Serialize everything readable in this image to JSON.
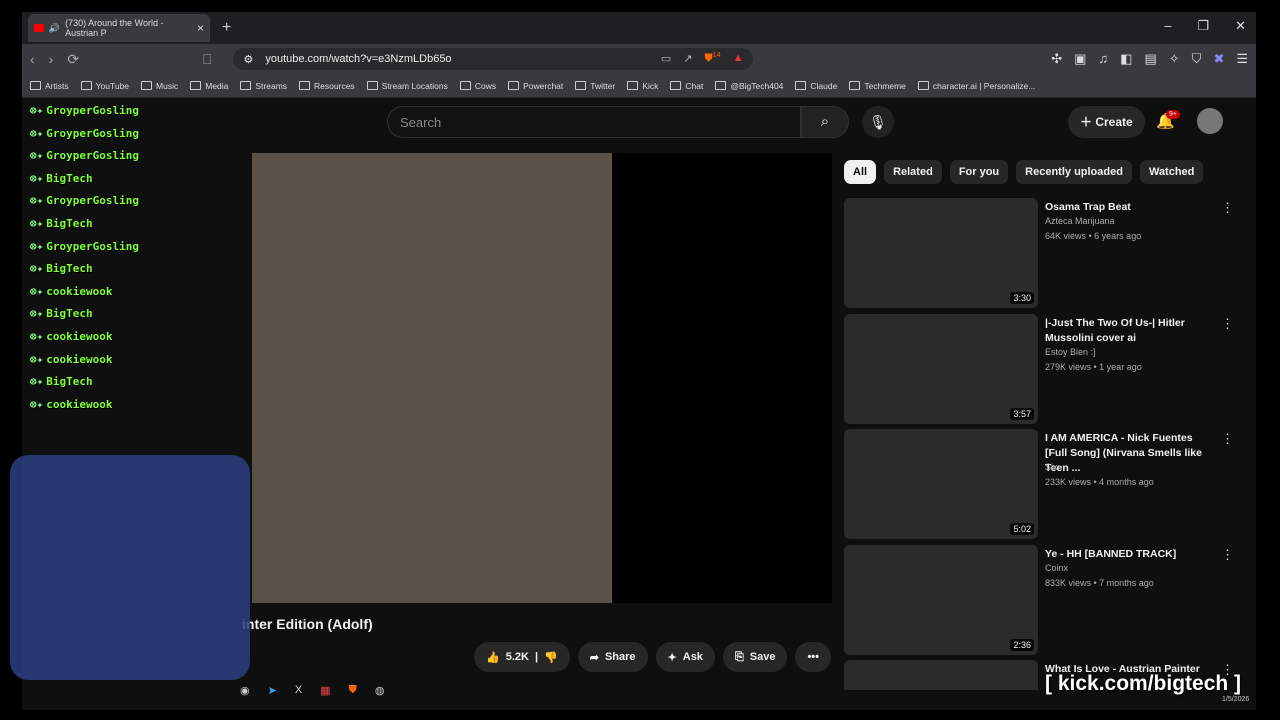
{
  "browser": {
    "tab_title": "(730) Around the World - Austrian P",
    "url": "youtube.com/watch?v=e3NzmLDb65o",
    "ext_badge": "14",
    "bookmarks": [
      "Artists",
      "YouTube",
      "Music",
      "Media",
      "Streams",
      "Resources",
      "Stream Locations",
      "Cows",
      "Powerchat",
      "Twitter",
      "Kick",
      "Chat",
      "@BigTech404",
      "Claude",
      "Techmeme",
      "character.ai | Personalize..."
    ]
  },
  "youtube": {
    "search_placeholder": "Search",
    "create_label": "Create",
    "notif_badge": "9+",
    "video_title_partial": "inter Edition (Adolf)",
    "actions": {
      "likes": "5.2K",
      "share": "Share",
      "ask": "Ask",
      "save": "Save"
    },
    "chips": [
      "All",
      "Related",
      "For you",
      "Recently uploaded",
      "Watched"
    ],
    "recs": [
      {
        "title": "Osama Trap Beat",
        "channel": "Azteca Marijuana",
        "meta": "64K views • 6 years ago",
        "duration": "3:30"
      },
      {
        "title": "|-Just The Two Of Us-| Hitler Mussolini cover ai",
        "channel": "Estoy Bien :]",
        "meta": "279K views • 1 year ago",
        "duration": "3:57"
      },
      {
        "title": "I AM AMERICA - Nick Fuentes [Full Song] (Nirvana Smells like Teen ...",
        "channel": "Six",
        "meta": "233K views • 4 months ago",
        "duration": "5:02"
      },
      {
        "title": "Ye - HH [BANNED TRACK]",
        "channel": "Coinx",
        "meta": "833K views • 7 months ago",
        "duration": "2:36"
      },
      {
        "title": "What Is Love - Austrian Painter",
        "channel": "",
        "meta": "",
        "duration": ""
      }
    ]
  },
  "chat": [
    "GroyperGosling",
    "GroyperGosling",
    "GroyperGosling",
    "BigTech",
    "GroyperGosling",
    "BigTech",
    "GroyperGosling",
    "BigTech",
    "cookiewook",
    "BigTech",
    "cookiewook",
    "cookiewook",
    "BigTech",
    "cookiewook"
  ],
  "overlay": {
    "kick": "[ kick.com/bigtech ]",
    "date": "1/5/2026"
  }
}
